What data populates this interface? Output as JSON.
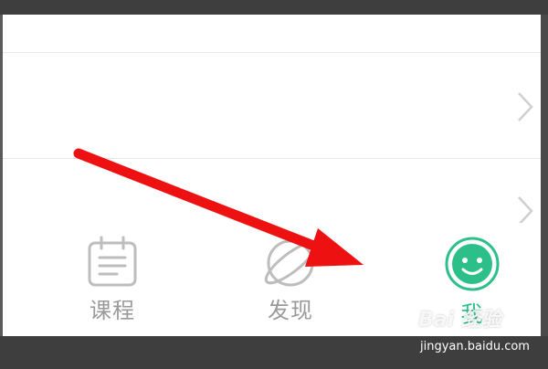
{
  "tabbar": {
    "tabs": [
      {
        "label": "课程",
        "icon": "calendar-icon",
        "active": false
      },
      {
        "label": "发现",
        "icon": "planet-icon",
        "active": false
      },
      {
        "label": "我",
        "icon": "smiley-icon",
        "active": true
      }
    ]
  },
  "colors": {
    "accent": "#2cbf8a",
    "inactive": "#9a9a9a",
    "arrow": "#ee1111"
  },
  "watermark": {
    "logo": "Bai 经验",
    "url": "jingyan.baidu.com"
  }
}
